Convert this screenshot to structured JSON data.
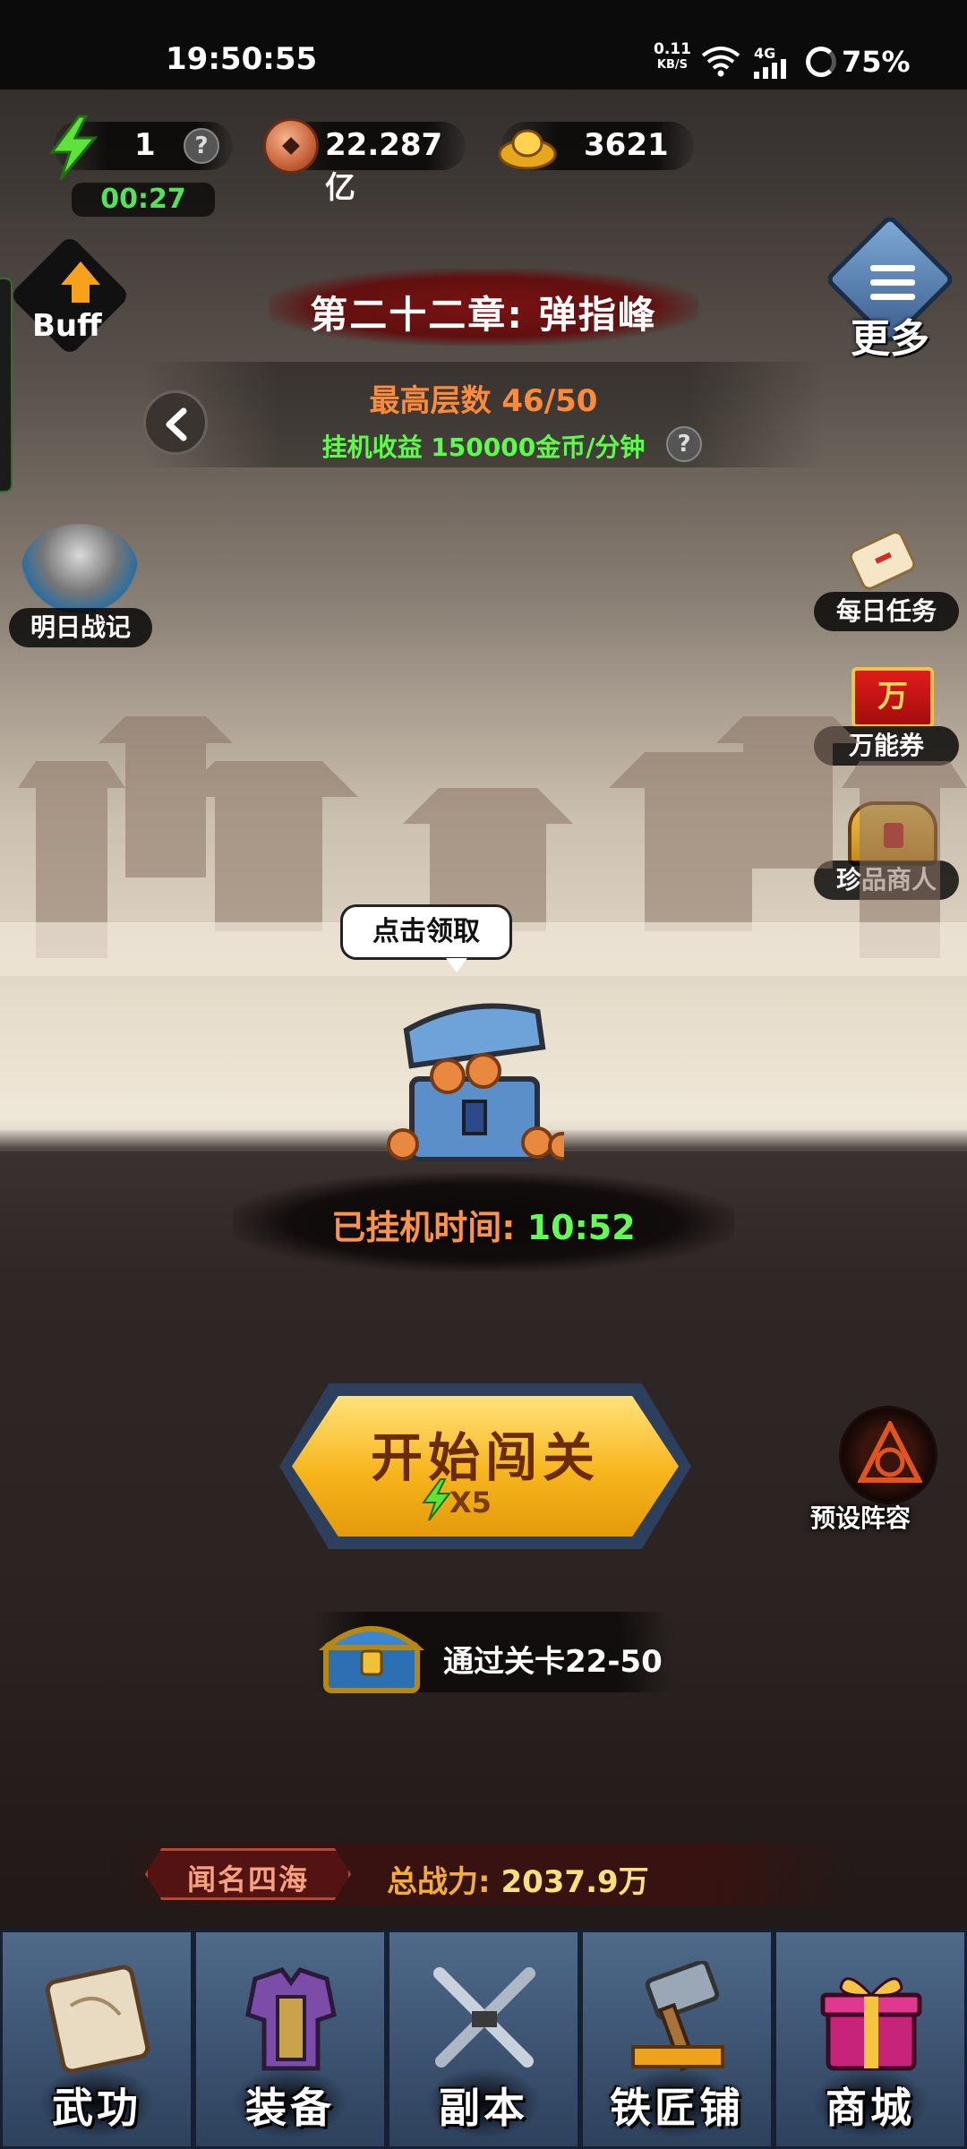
{
  "status_bar": {
    "time": "19:50:55",
    "net_speed": "0.11",
    "net_unit": "KB/S",
    "network_type": "4G",
    "battery": "75%"
  },
  "resources": {
    "energy": {
      "value": "1",
      "timer": "00:27",
      "icon": "lightning-icon"
    },
    "coins": {
      "value": "22.287亿",
      "icon": "copper-coin-icon"
    },
    "ingots": {
      "value": "3621",
      "icon": "gold-ingot-icon"
    }
  },
  "buff": {
    "label": "Buff"
  },
  "more": {
    "label": "更多"
  },
  "chapter": {
    "title": "第二十二章: 弹指峰",
    "max_floor": "最高层数 46/50",
    "idle_income": "挂机收益 150000金币/分钟"
  },
  "left_side": {
    "memo": {
      "label": "明日战记"
    }
  },
  "right_side": {
    "daily_tasks": {
      "label": "每日任务"
    },
    "voucher": {
      "label": "万能券",
      "glyph": "万"
    },
    "merchant": {
      "label": "珍品商人"
    },
    "preset": {
      "label": "预设阵容"
    }
  },
  "idle": {
    "bubble": "点击领取",
    "time_label": "已挂机时间: ",
    "time_value": "10:52"
  },
  "start": {
    "label": "开始闯关",
    "cost": "X5"
  },
  "clear_reward": {
    "label": "通过关卡22-50"
  },
  "power": {
    "fame": "闻名四海",
    "label": "总战力: ",
    "value": "2037.9万"
  },
  "nav": [
    {
      "label": "武功",
      "icon": "scroll-book-icon"
    },
    {
      "label": "装备",
      "icon": "armor-icon"
    },
    {
      "label": "副本",
      "icon": "crossed-swords-icon"
    },
    {
      "label": "铁匠铺",
      "icon": "hammer-icon"
    },
    {
      "label": "商城",
      "icon": "gift-box-icon"
    }
  ],
  "colors": {
    "accent_orange": "#ff8a3a",
    "income_green": "#5bff4a",
    "start_gold": "#f7b51c",
    "nav_blue": "#4f6a8b"
  }
}
